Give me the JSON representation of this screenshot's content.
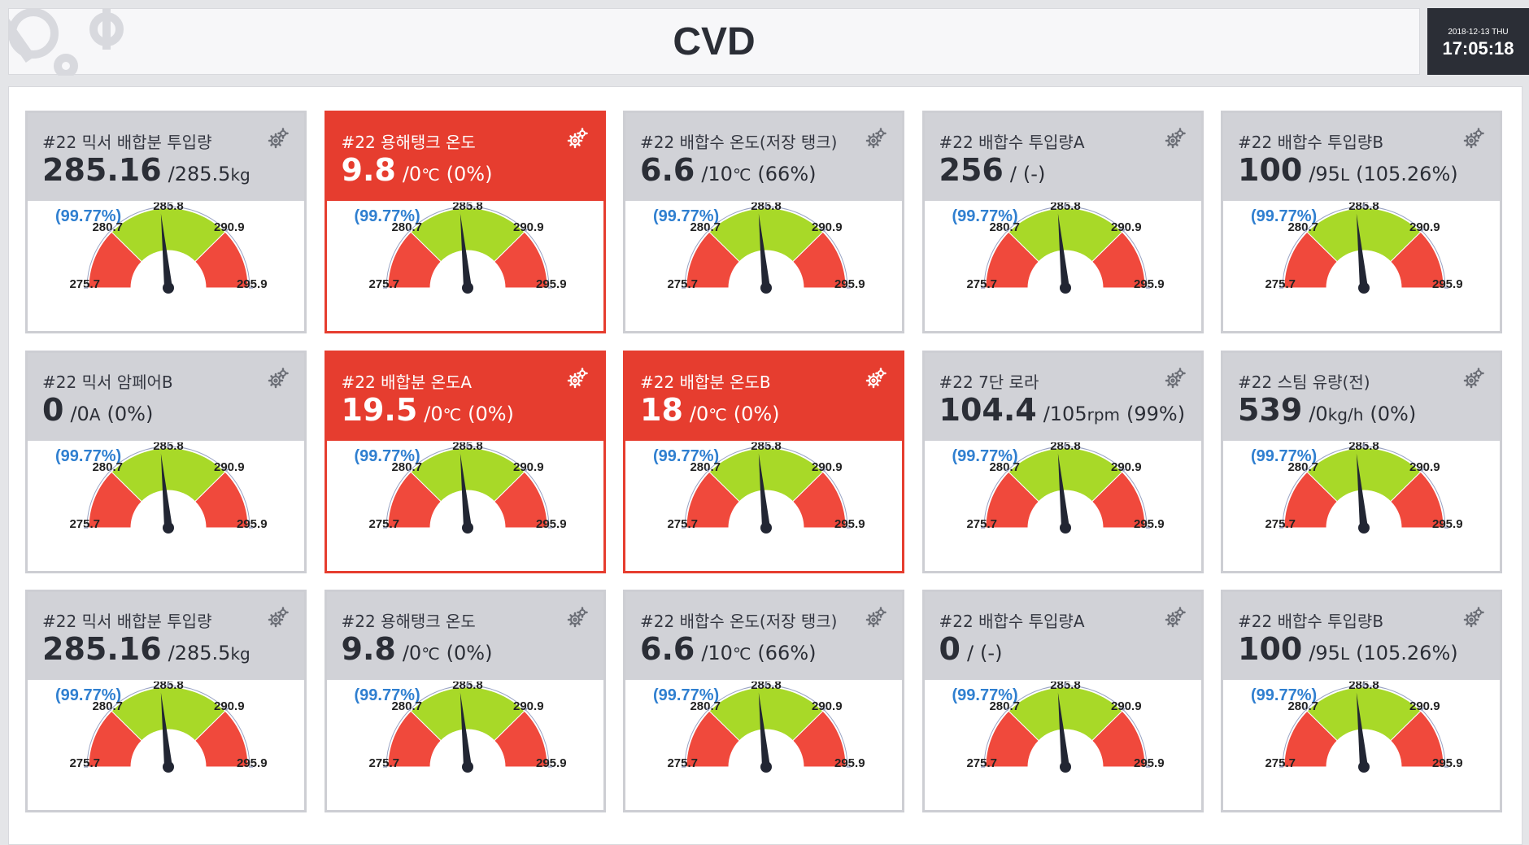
{
  "header": {
    "title": "CVD",
    "date": "2018-12-13 THU",
    "time": "17:05:18"
  },
  "colors": {
    "normal_header": "#d1d2d7",
    "alert_header": "#e63d2f",
    "gauge_green": "#a8d928",
    "gauge_red": "#f0493c",
    "pct_text": "#2f7fd0"
  },
  "gauge_common": {
    "percent": "(99.77%)",
    "ticks": [
      "275.7",
      "280.7",
      "285.8",
      "290.9",
      "295.9"
    ],
    "min": 275.7,
    "max": 295.9,
    "green_from": 280.7,
    "green_to": 290.9,
    "needle_value": 285.16
  },
  "cards": [
    {
      "title": "#22 믹서 배합분 투입량",
      "value": "285.16",
      "target": "/285.5",
      "unit": "kg",
      "percent": "",
      "alert": false
    },
    {
      "title": "#22 용해탱크 온도",
      "value": "9.8",
      "target": "/0",
      "unit": "℃",
      "percent": "(0%)",
      "alert": true
    },
    {
      "title": "#22 배합수 온도(저장 탱크)",
      "value": "6.6",
      "target": "/10",
      "unit": "℃",
      "percent": "(66%)",
      "alert": false
    },
    {
      "title": "#22 배합수 투입량A",
      "value": "256",
      "target": "/",
      "unit": "",
      "percent": "(-)",
      "alert": false
    },
    {
      "title": "#22 배합수 투입량B",
      "value": "100",
      "target": "/95",
      "unit": "L",
      "percent": "(105.26%)",
      "alert": false
    },
    {
      "title": "#22 믹서 암페어B",
      "value": "0",
      "target": "/0",
      "unit": "A",
      "percent": "(0%)",
      "alert": false
    },
    {
      "title": "#22 배합분 온도A",
      "value": "19.5",
      "target": "/0",
      "unit": "℃",
      "percent": "(0%)",
      "alert": true
    },
    {
      "title": "#22 배합분 온도B",
      "value": "18",
      "target": "/0",
      "unit": "℃",
      "percent": "(0%)",
      "alert": true
    },
    {
      "title": "#22 7단 로라",
      "value": "104.4",
      "target": "/105",
      "unit": "rpm",
      "percent": "(99%)",
      "alert": false
    },
    {
      "title": "#22 스팀 유량(전)",
      "value": "539",
      "target": "/0",
      "unit": "kg/h",
      "percent": "(0%)",
      "alert": false
    },
    {
      "title": "#22 믹서 배합분 투입량",
      "value": "285.16",
      "target": "/285.5",
      "unit": "kg",
      "percent": "",
      "alert": false
    },
    {
      "title": "#22 용해탱크 온도",
      "value": "9.8",
      "target": "/0",
      "unit": "℃",
      "percent": "(0%)",
      "alert": false
    },
    {
      "title": "#22 배합수 온도(저장 탱크)",
      "value": "6.6",
      "target": "/10",
      "unit": "℃",
      "percent": "(66%)",
      "alert": false
    },
    {
      "title": "#22 배합수 투입량A",
      "value": "0",
      "target": "/",
      "unit": "",
      "percent": "(-)",
      "alert": false
    },
    {
      "title": "#22 배합수 투입량B",
      "value": "100",
      "target": "/95",
      "unit": "L",
      "percent": "(105.26%)",
      "alert": false
    }
  ]
}
